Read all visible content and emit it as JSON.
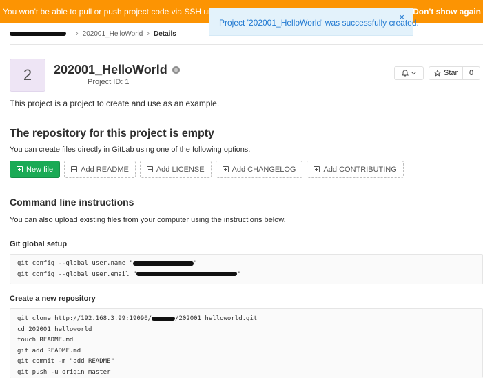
{
  "banner": {
    "message": "You won't be able to pull or push project code via SSH until yo",
    "dismiss": "Don't show again"
  },
  "flash": {
    "message": "Project '202001_HelloWorld' was successfully created.",
    "close": "×"
  },
  "breadcrumb": {
    "project": "202001_HelloWorld",
    "current": "Details"
  },
  "project": {
    "avatar_letter": "2",
    "name": "202001_HelloWorld",
    "id_label": "Project ID: 1",
    "description": "This project is a project to create and use as an example."
  },
  "actions": {
    "star_label": "Star",
    "star_count": "0"
  },
  "empty_repo": {
    "heading": "The repository for this project is empty",
    "subtext": "You can create files directly in GitLab using one of the following options.",
    "buttons": [
      "New file",
      "Add README",
      "Add LICENSE",
      "Add CHANGELOG",
      "Add CONTRIBUTING"
    ]
  },
  "cli": {
    "heading": "Command line instructions",
    "subtext": "You can also upload existing files from your computer using the instructions below.",
    "global_setup": {
      "heading": "Git global setup",
      "line1_prefix": "git config --global user.name \"",
      "line1_suffix": "\"",
      "line2_prefix": "git config --global user.email \"",
      "line2_suffix": "\""
    },
    "new_repo": {
      "heading": "Create a new repository",
      "clone_prefix": "git clone http://192.168.3.99:19090/",
      "clone_suffix": "/202001_helloworld.git",
      "lines": [
        "cd 202001_helloworld",
        "touch README.md",
        "git add README.md",
        "git commit -m \"add README\"",
        "git push -u origin master"
      ]
    }
  },
  "icons": {
    "bell": "bell-icon",
    "star": "star-icon",
    "globe": "globe-icon",
    "close": "close-icon",
    "plus": "plus-square-icon"
  },
  "colors": {
    "banner": "#fc9403",
    "flash_bg": "#e3f2fb",
    "flash_text": "#1f78d1",
    "primary_green": "#1aaa55",
    "avatar_bg": "#eee5f5"
  }
}
